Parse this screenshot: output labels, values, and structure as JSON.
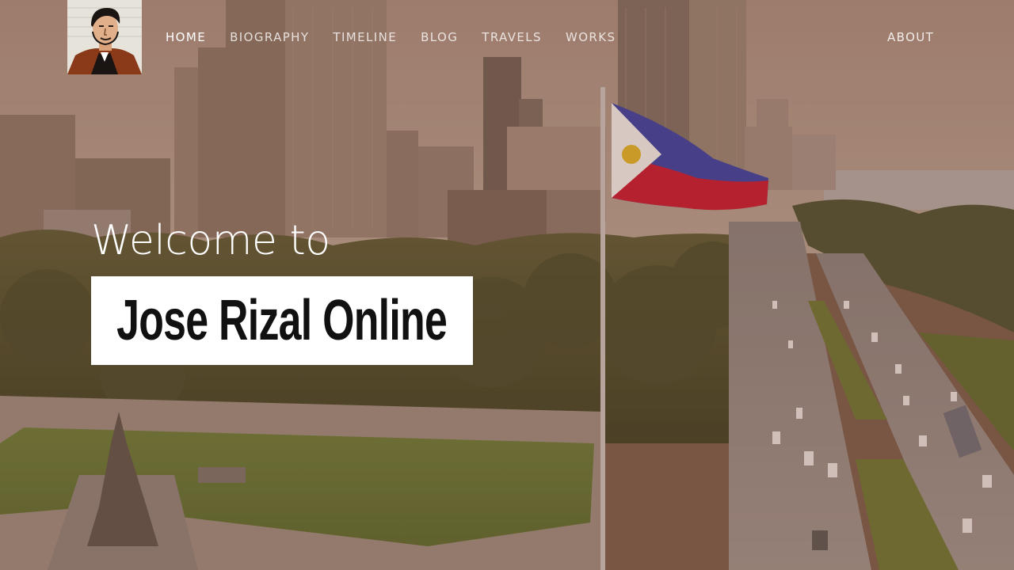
{
  "site": {
    "logo_alt": "Jose Rizal portrait logo"
  },
  "nav": {
    "items": [
      {
        "label": "HOME",
        "active": true
      },
      {
        "label": "BIOGRAPHY",
        "active": false
      },
      {
        "label": "TIMELINE",
        "active": false
      },
      {
        "label": "BLOG",
        "active": false
      },
      {
        "label": "TRAVELS",
        "active": false
      },
      {
        "label": "WORKS",
        "active": false
      }
    ],
    "right_label": "ABOUT"
  },
  "hero": {
    "welcome": "Welcome to",
    "title": "Jose Rizal Online"
  },
  "colors": {
    "overlay": "#7a4632",
    "title_bg": "#ffffff",
    "title_text": "#111111",
    "nav_text": "#ffffff"
  },
  "icons": {
    "logo": "rizal-portrait-icon"
  }
}
